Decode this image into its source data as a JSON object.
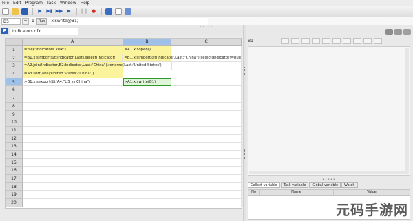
{
  "menu": [
    "File",
    "Edit",
    "Program",
    "Task",
    "Window",
    "Help"
  ],
  "toolbar": {
    "icons": [
      "new-file-icon",
      "open-folder-icon",
      "save-icon",
      "run-icon",
      "run-to-cursor-icon",
      "step-into-icon",
      "step-icon",
      "pause-icon",
      "stop-icon",
      "calculate-icon",
      "execute-icon",
      "options-icon"
    ]
  },
  "formula_bar": {
    "cell_ref": "B5",
    "eq": "=",
    "step": "1",
    "run_label": "Run",
    "formula": "xlswrite@B1)"
  },
  "file_tab": {
    "icon_letter": "P",
    "name": "Indicators.dfx"
  },
  "grid": {
    "columns": [
      "A",
      "B",
      "C"
    ],
    "active_column": "B",
    "active_row": 5,
    "rows": [
      {
        "num": "1",
        "a": "=file(\"Indicators.xlsx\")",
        "b": "=A1.xlsopen()",
        "c": ""
      },
      {
        "num": "2",
        "a": "=B1.xlsimport@t(Indicator,Last).select(Indicator!",
        "b": "=B1.xlsimport@t(Indicator,Last;\"China\").select(Indicator!=null)",
        "c": ""
      },
      {
        "num": "3",
        "a": "=A2.join(Indicator,B2:Indicator,Last:\"China\").rename(Last:'United States')",
        "b": "",
        "c": ""
      },
      {
        "num": "4",
        "a": "=A3.sort(abs('United States'-'China'))",
        "b": "",
        "c": ""
      },
      {
        "num": "5",
        "a": ">B1.xlsexport@t(A4;\"US vs China\")",
        "b": ">A1.xlswrite(B1)",
        "c": ""
      },
      {
        "num": "6",
        "a": "",
        "b": "",
        "c": ""
      },
      {
        "num": "7",
        "a": "",
        "b": "",
        "c": ""
      },
      {
        "num": "8",
        "a": "",
        "b": "",
        "c": ""
      },
      {
        "num": "9",
        "a": "",
        "b": "",
        "c": ""
      },
      {
        "num": "10",
        "a": "",
        "b": "",
        "c": ""
      },
      {
        "num": "11",
        "a": "",
        "b": "",
        "c": ""
      },
      {
        "num": "12",
        "a": "",
        "b": "",
        "c": ""
      },
      {
        "num": "13",
        "a": "",
        "b": "",
        "c": ""
      },
      {
        "num": "14",
        "a": "",
        "b": "",
        "c": ""
      },
      {
        "num": "15",
        "a": "",
        "b": "",
        "c": ""
      },
      {
        "num": "16",
        "a": "",
        "b": "",
        "c": ""
      },
      {
        "num": "17",
        "a": "",
        "b": "",
        "c": ""
      },
      {
        "num": "18",
        "a": "",
        "b": "",
        "c": ""
      },
      {
        "num": "19",
        "a": "",
        "b": "",
        "c": ""
      },
      {
        "num": "20",
        "a": "",
        "b": "",
        "c": ""
      }
    ]
  },
  "right_panel": {
    "cell_label": "B1",
    "tabs": [
      "Cellset variable",
      "Task variable",
      "Global variable",
      "Watch"
    ],
    "selected_tab": "Cellset variable",
    "table_headers": [
      "No",
      "Name",
      "Value"
    ]
  },
  "watermark": "元码手游网",
  "colors": {
    "yellow_cell": "#fbf49c",
    "active_header": "#9fc0e8",
    "active_cell_border": "#2e9a2e"
  }
}
